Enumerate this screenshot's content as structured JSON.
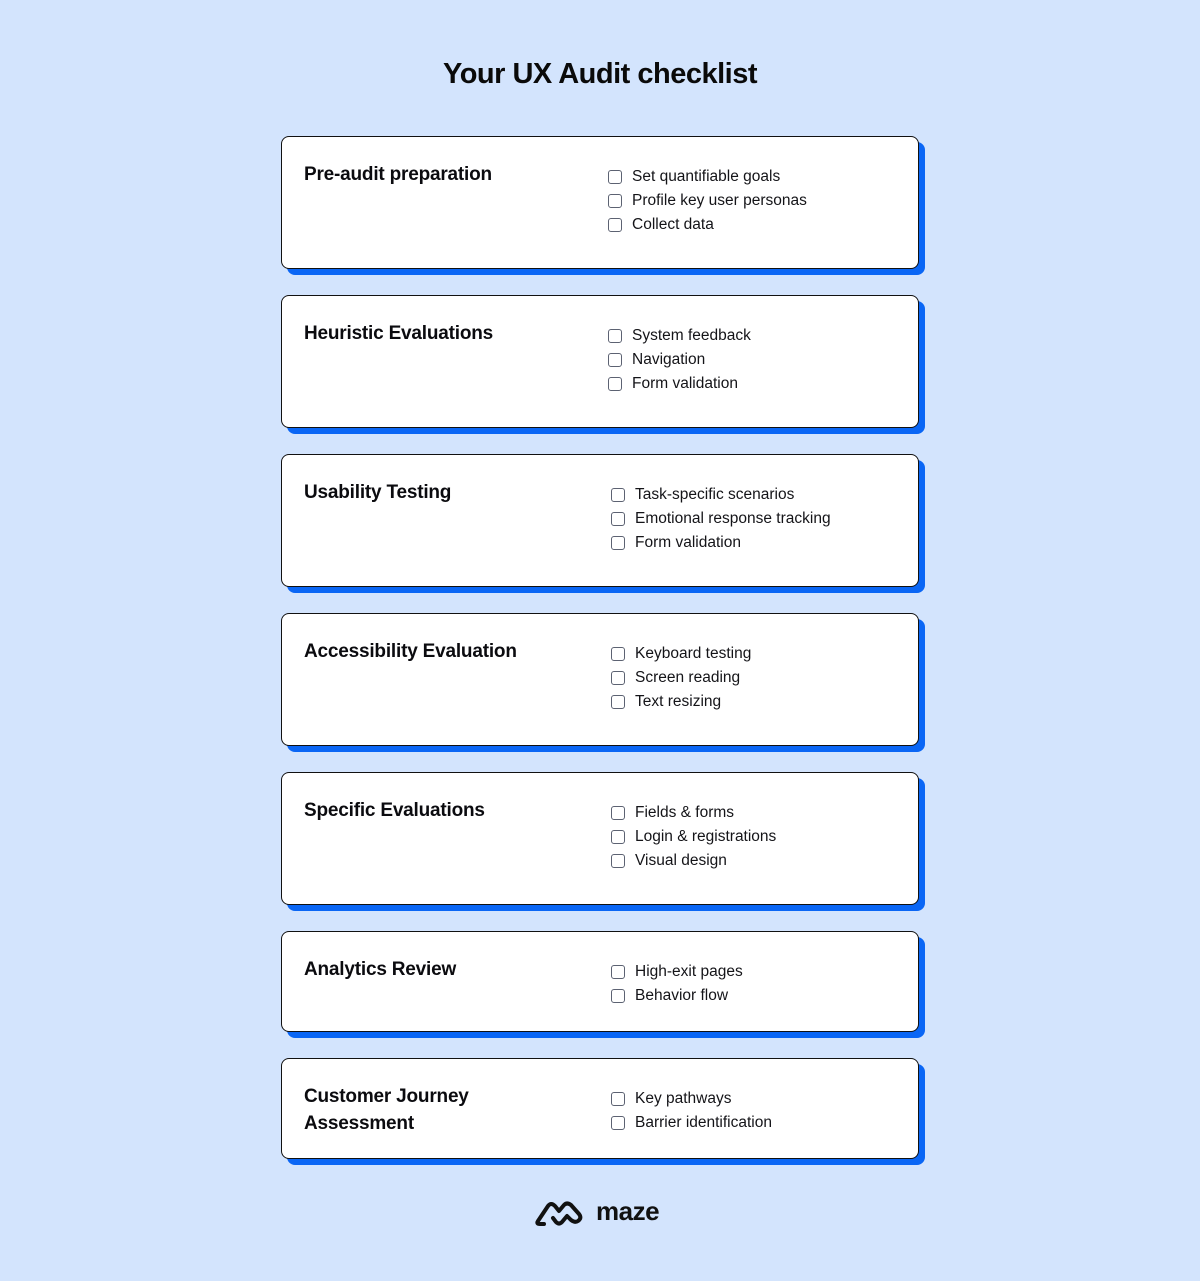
{
  "title": "Your UX Audit checklist",
  "colors": {
    "background": "#d3e4fd",
    "card": "#ffffff",
    "shadow": "#0a66f5",
    "text": "#0b0b0f"
  },
  "cards": [
    {
      "title": "Pre-audit preparation",
      "items": [
        "Set quantifiable goals",
        "Profile key user personas",
        "Collect data"
      ]
    },
    {
      "title": "Heuristic Evaluations",
      "items": [
        "System feedback",
        "Navigation",
        "Form validation"
      ]
    },
    {
      "title": "Usability Testing",
      "items": [
        "Task-specific scenarios",
        "Emotional response tracking",
        "Form validation"
      ]
    },
    {
      "title": "Accessibility Evaluation",
      "items": [
        "Keyboard testing",
        "Screen reading",
        "Text resizing"
      ]
    },
    {
      "title": "Specific Evaluations",
      "items": [
        "Fields & forms",
        "Login & registrations",
        "Visual design"
      ]
    },
    {
      "title": "Analytics Review",
      "items": [
        "High-exit pages",
        "Behavior flow"
      ]
    },
    {
      "title": "Customer Journey Assessment",
      "items": [
        "Key pathways",
        "Barrier identification"
      ]
    }
  ],
  "footer": {
    "brand": "maze",
    "logo_icon": "maze-logo-icon"
  }
}
